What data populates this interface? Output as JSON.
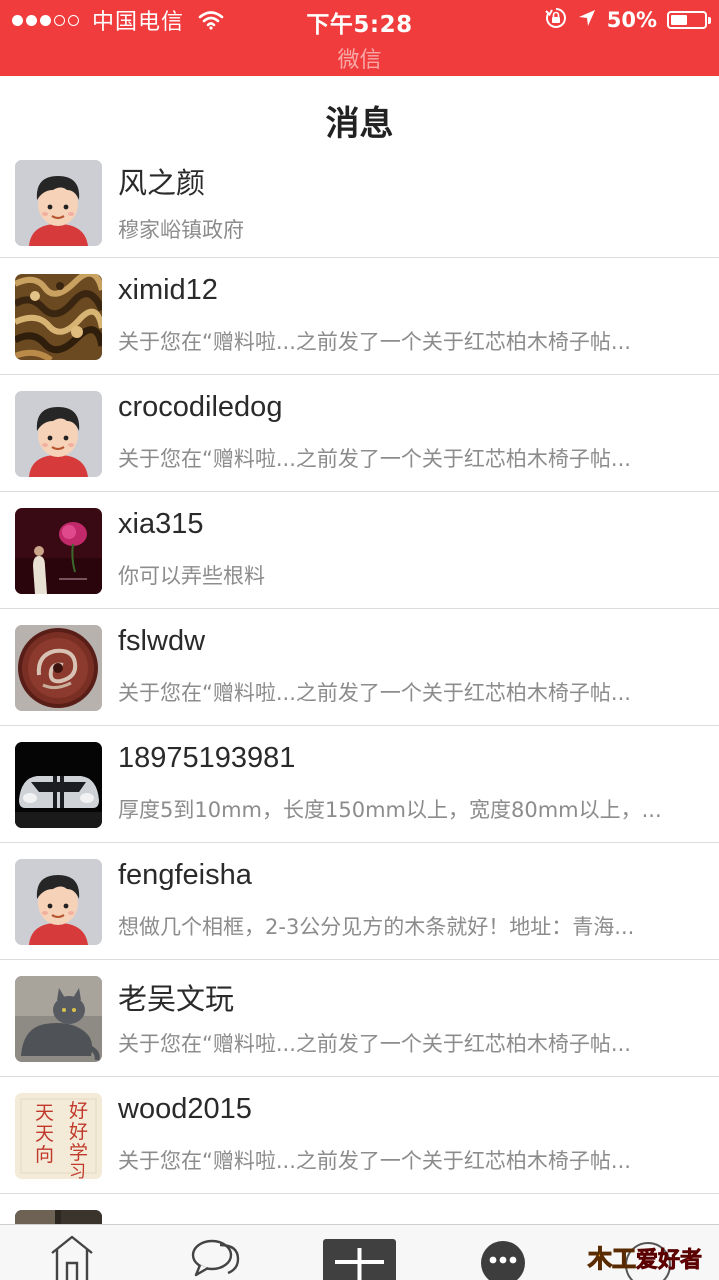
{
  "status_bar": {
    "carrier": "中国电信",
    "time": "下午5:28",
    "app_back_label": "微信",
    "battery_percent": "50%",
    "battery_level": 0.5,
    "signal_bars": 3,
    "signal_total": 5,
    "background_color": "#f03c3c"
  },
  "header": {
    "title": "消息"
  },
  "messages": [
    {
      "name": "风之颜",
      "preview": "穆家峪镇政府",
      "avatar": "cartoon-boy"
    },
    {
      "name": "ximid12",
      "preview": "关于您在“赠料啦...之前发了一个关于红芯柏木椅子帖...",
      "avatar": "wood-texture"
    },
    {
      "name": "crocodiledog",
      "preview": "关于您在“赠料啦...之前发了一个关于红芯柏木椅子帖...",
      "avatar": "cartoon-boy"
    },
    {
      "name": "xia315",
      "preview": "你可以弄些根料",
      "avatar": "rose-woman"
    },
    {
      "name": "fslwdw",
      "preview": "关于您在“赠料啦...之前发了一个关于红芯柏木椅子帖...",
      "avatar": "carved-disc"
    },
    {
      "name": "18975193981",
      "preview": "厚度5到10mm，长度150mm以上，宽度80mm以上，...",
      "avatar": "car"
    },
    {
      "name": "fengfeisha",
      "preview": "想做几个相框，2-3公分见方的木条就好！地址：青海...",
      "avatar": "cartoon-boy"
    },
    {
      "name": "老吴文玩",
      "preview": "关于您在“赠料啦...之前发了一个关于红芯柏木椅子帖...",
      "avatar": "grey-cat"
    },
    {
      "name": "wood2015",
      "preview": "关于您在“赠料啦...之前发了一个关于红芯柏木椅子帖...",
      "avatar": "calligraphy"
    },
    {
      "name": "",
      "preview": "",
      "avatar": "dark-photo"
    }
  ],
  "avatar_calligraphy_text": "天天向上 好好学习",
  "tab_bar": {
    "items": [
      {
        "icon": "home-icon"
      },
      {
        "icon": "chat-bubbles-icon"
      },
      {
        "icon": "plus-icon"
      },
      {
        "icon": "more-icon"
      },
      {
        "icon": "brand-logo",
        "logo_text": "木工爱好者"
      }
    ]
  }
}
